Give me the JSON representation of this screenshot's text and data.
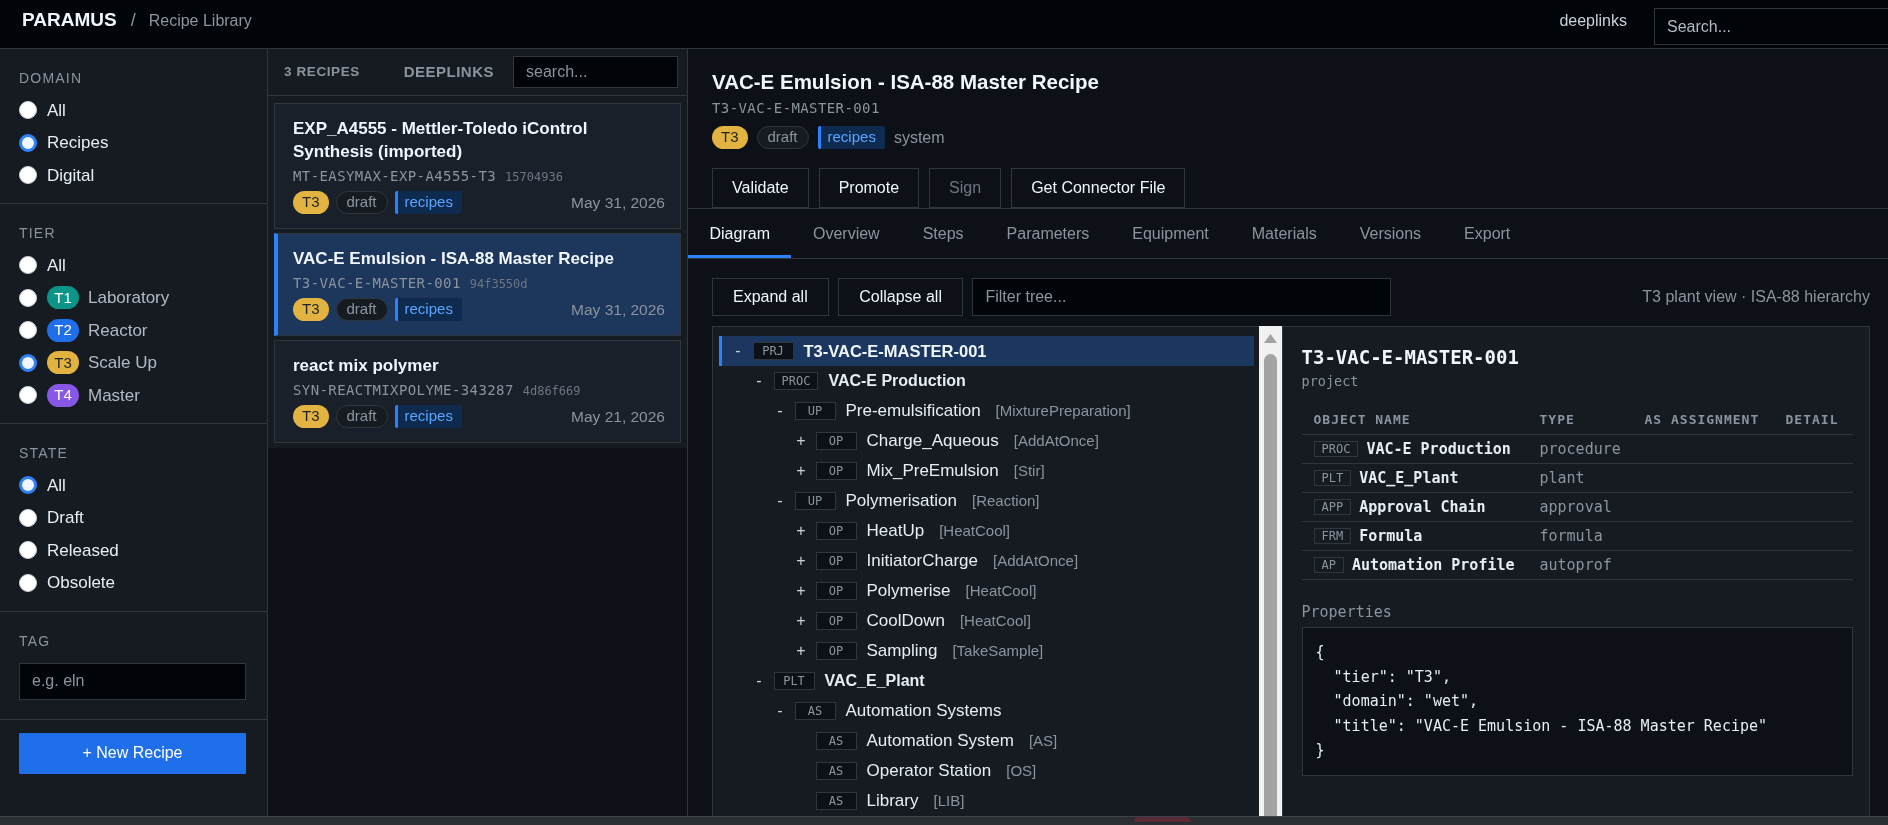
{
  "navbar": {
    "brand": "PARAMUS",
    "separator": "/",
    "page": "Recipe Library",
    "link": "deeplinks",
    "search": {
      "placeholder": "Search..."
    }
  },
  "filters": [
    {
      "title": "DOMAIN",
      "options": [
        {
          "label": "All",
          "selected": false
        },
        {
          "label": "Recipes",
          "selected": true
        },
        {
          "label": "Digital",
          "selected": false
        }
      ]
    },
    {
      "title": "TIER",
      "options": [
        {
          "label": "All",
          "selected": false
        },
        {
          "badge": "T1",
          "color": "#0d9488",
          "label": "Laboratory",
          "selected": false
        },
        {
          "badge": "T2",
          "color": "#1f6feb",
          "label": "Reactor",
          "selected": false
        },
        {
          "badge": "T3",
          "color": "#e3b341",
          "label": "Scale Up",
          "selected": true
        },
        {
          "badge": "T4",
          "color": "#8957e5",
          "label": "Master",
          "selected": false
        }
      ]
    },
    {
      "title": "STATE",
      "options": [
        {
          "label": "All",
          "selected": true
        },
        {
          "label": "Draft",
          "selected": false
        },
        {
          "label": "Released",
          "selected": false
        },
        {
          "label": "Obsolete",
          "selected": false
        }
      ]
    }
  ],
  "tag_filter": {
    "title": "TAG",
    "placeholder": "e.g. eln"
  },
  "new_recipe_button": "+ New Recipe",
  "recipe_list": {
    "count": "3 RECIPES",
    "link": "DEEPLINKS",
    "search": {
      "placeholder": "search..."
    },
    "recipes": [
      {
        "title": "EXP_A4555 - Mettler-Toledo iControl Synthesis (imported)",
        "code": "MT-EASYMAX-EXP-A4555-T3",
        "hash": "15704936",
        "tier": {
          "label": "T3",
          "color": "#e3b341"
        },
        "state": "draft",
        "tag": "recipes",
        "date": "May 31, 2026",
        "selected": false
      },
      {
        "title": "VAC-E Emulsion - ISA-88 Master Recipe",
        "code": "T3-VAC-E-MASTER-001",
        "hash": "94f3550d",
        "tier": {
          "label": "T3",
          "color": "#e3b341"
        },
        "state": "draft",
        "tag": "recipes",
        "date": "May 31, 2026",
        "selected": true
      },
      {
        "title": "react mix polymer",
        "code": "SYN-REACTMIXPOLYME-343287",
        "hash": "4d86f669",
        "tier": {
          "label": "T3",
          "color": "#e3b341"
        },
        "state": "draft",
        "tag": "recipes",
        "date": "May 21, 2026",
        "selected": false
      }
    ]
  },
  "detail": {
    "title": "VAC-E Emulsion - ISA-88 Master Recipe",
    "code": "T3-VAC-E-MASTER-001",
    "tier": {
      "label": "T3",
      "color": "#e3b341"
    },
    "state": "draft",
    "tag": "recipes",
    "owner": "system",
    "actions": [
      {
        "label": "Validate",
        "disabled": false
      },
      {
        "label": "Promote",
        "disabled": false
      },
      {
        "label": "Sign",
        "disabled": true
      },
      {
        "label": "Get Connector File",
        "disabled": false
      }
    ],
    "tabs": [
      {
        "label": "Diagram",
        "selected": true
      },
      {
        "label": "Overview",
        "selected": false
      },
      {
        "label": "Steps",
        "selected": false
      },
      {
        "label": "Parameters",
        "selected": false
      },
      {
        "label": "Equipment",
        "selected": false
      },
      {
        "label": "Materials",
        "selected": false
      },
      {
        "label": "Versions",
        "selected": false
      },
      {
        "label": "Export",
        "selected": false
      }
    ],
    "diagram": {
      "buttons": [
        "Expand all",
        "Collapse all"
      ],
      "filter": {
        "placeholder": "Filter tree..."
      },
      "caption": "T3 plant view · ISA-88 hierarchy",
      "tree": [
        {
          "tag": "PRJ",
          "label": "T3-VAC-E-MASTER-001",
          "toggle": "-",
          "selected": true,
          "children": [
            {
              "tag": "PROC",
              "label": "VAC-E Production",
              "toggle": "-",
              "selected": false,
              "children": [
                {
                  "tag": "UP",
                  "label": "Pre-emulsification",
                  "class": "[MixturePreparation]",
                  "toggle": "-",
                  "selected": false,
                  "children": [
                    {
                      "tag": "OP",
                      "label": "Charge_Aqueous",
                      "class": "[AddAtOnce]",
                      "toggle": "+",
                      "selected": false
                    },
                    {
                      "tag": "OP",
                      "label": "Mix_PreEmulsion",
                      "class": "[Stir]",
                      "toggle": "+",
                      "selected": false
                    }
                  ]
                },
                {
                  "tag": "UP",
                  "label": "Polymerisation",
                  "class": "[Reaction]",
                  "toggle": "-",
                  "selected": false,
                  "children": [
                    {
                      "tag": "OP",
                      "label": "HeatUp",
                      "class": "[HeatCool]",
                      "toggle": "+",
                      "selected": false
                    },
                    {
                      "tag": "OP",
                      "label": "InitiatorCharge",
                      "class": "[AddAtOnce]",
                      "toggle": "+",
                      "selected": false
                    },
                    {
                      "tag": "OP",
                      "label": "Polymerise",
                      "class": "[HeatCool]",
                      "toggle": "+",
                      "selected": false
                    },
                    {
                      "tag": "OP",
                      "label": "CoolDown",
                      "class": "[HeatCool]",
                      "toggle": "+",
                      "selected": false
                    },
                    {
                      "tag": "OP",
                      "label": "Sampling",
                      "class": "[TakeSample]",
                      "toggle": "+",
                      "selected": false
                    }
                  ]
                }
              ]
            },
            {
              "tag": "PLT",
              "label": "VAC_E_Plant",
              "toggle": "-",
              "selected": false,
              "children": [
                {
                  "tag": "AS",
                  "label": "Automation Systems",
                  "toggle": "-",
                  "selected": false,
                  "children": [
                    {
                      "tag": "AS",
                      "label": "Automation System",
                      "class": "[AS]",
                      "selected": false
                    },
                    {
                      "tag": "AS",
                      "label": "Operator Station",
                      "class": "[OS]",
                      "selected": false
                    },
                    {
                      "tag": "AS",
                      "label": "Library",
                      "class": "[LIB]",
                      "selected": false
                    }
                  ]
                }
              ]
            }
          ]
        }
      ],
      "inspector": {
        "title": "T3-VAC-E-MASTER-001",
        "type": "project",
        "columns": [
          "OBJECT NAME",
          "TYPE",
          "AS ASSIGNMENT",
          "DETAIL"
        ],
        "rows": [
          {
            "tag": "PROC",
            "name": "VAC-E Production",
            "type": "procedure"
          },
          {
            "tag": "PLT",
            "name": "VAC_E_Plant",
            "type": "plant"
          },
          {
            "tag": "APP",
            "name": "Approval Chain",
            "type": "approval"
          },
          {
            "tag": "FRM",
            "name": "Formula",
            "type": "formula"
          },
          {
            "tag": "AP",
            "name": "Automation Profile",
            "type": "autoprof"
          }
        ],
        "properties_label": "Properties",
        "properties": "{\n  \"tier\": \"T3\",\n  \"domain\": \"wet\",\n  \"title\": \"VAC-E Emulsion - ISA-88 Master Recipe\"\n}"
      }
    }
  }
}
